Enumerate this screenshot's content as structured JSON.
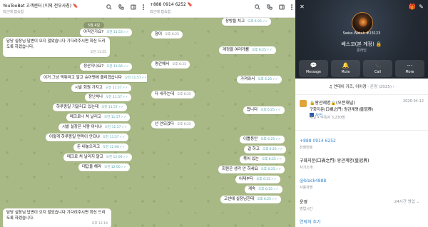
{
  "left": {
    "title": "YouTooBet 고객센터 (이외 전부사칭)",
    "title_badge": "🔖",
    "subtitle": "최근에 접속함",
    "date_chip": "5월 4일",
    "messages": [
      {
        "text": "아직인가요?",
        "time": "오전 11:53",
        "checks": "✓✓"
      },
      {
        "text": "담당 실장님 답변이 오지 않았습니다 기다려주시면 회신 드리도록 하겠습니다.",
        "time": "오전 11:55",
        "checks": ""
      },
      {
        "text": "정산지나요?",
        "time": "오전 11:56",
        "checks": "✓✓"
      },
      {
        "text": "이거 그냥 먹튀라고 알고 슈어맨에 올리겠습니다",
        "time": "오전 11:57",
        "checks": "✓✓"
      },
      {
        "text": "시발 회원 가지고",
        "time": "오전 11:57",
        "checks": "✓✓"
      },
      {
        "text": "장난치나",
        "time": "오전 11:57",
        "checks": "✓✓"
      },
      {
        "text": "하루종일 기달리고 있는데",
        "time": "오전 11:57",
        "checks": "✓✓"
      },
      {
        "text": "매크로나 처 날리고",
        "time": "오전 11:57",
        "checks": "✓✓"
      },
      {
        "text": "시발 실장은 사람 아니냐",
        "time": "오전 11:57",
        "checks": "✓✓"
      },
      {
        "text": "어떻게 하루종일 연락이 안되냐",
        "time": "오전 11:57",
        "checks": "✓✓"
      },
      {
        "text": "돈 내놓으라고",
        "time": "오전 12:00",
        "checks": "✓✓"
      },
      {
        "text": "매크로 처 날리지 말고",
        "time": "오전 12:00",
        "checks": "✓✓"
      },
      {
        "text": "대답을 해라",
        "time": "오전 12:00",
        "checks": "✓✓"
      },
      {
        "text": "담당 실장님 답변이 오지 않았습니다 기다려주시면 회신 드리도록 하겠습니다.",
        "time": "오후 12:14",
        "checks": ""
      }
    ]
  },
  "mid": {
    "title": "+888 0914 6252",
    "title_badge": "🔖",
    "subtitle": "최근에 접속함",
    "messages": [
      {
        "text": "장방을 치고",
        "time": "오후 6:25",
        "checks": "✓✓",
        "side": "out"
      },
      {
        "text": "형이",
        "time": "오후 6:25",
        "checks": "",
        "side": "in"
      },
      {
        "text": "계정을 여러개를",
        "time": "오후 6:25",
        "checks": "✓✓",
        "side": "out"
      },
      {
        "text": "명간해서",
        "time": "오후 6:25",
        "checks": "",
        "side": "in"
      },
      {
        "text": "가져와서",
        "time": "오후 6:25",
        "checks": "✓✓",
        "side": "out"
      },
      {
        "text": "다 내주는데",
        "time": "오후 6:25",
        "checks": "",
        "side": "in"
      },
      {
        "text": "합니다",
        "time": "오후 6:25",
        "checks": "✓✓",
        "side": "out"
      },
      {
        "text": "넌 안되겠다",
        "time": "오후 6:25",
        "checks": "",
        "side": "in"
      },
      {
        "text": "이틀동안",
        "time": "오후 6:25",
        "checks": "✓✓",
        "side": "out"
      },
      {
        "text": "걸 하고",
        "time": "오후 6:25",
        "checks": "✓✓",
        "side": "out"
      },
      {
        "text": "묶어 있는",
        "time": "오후 6:25",
        "checks": "✓✓",
        "side": "out"
      },
      {
        "text": "회원은 생각 안 하세요",
        "time": "오후 6:25",
        "checks": "✓✓",
        "side": "out"
      },
      {
        "text": "어제부터",
        "time": "오후 6:25",
        "checks": "✓✓",
        "side": "out"
      },
      {
        "text": "계속",
        "time": "오후 6:25",
        "checks": "✓✓",
        "side": "out"
      },
      {
        "text": "고센에 실장님한테",
        "time": "오후 6:25",
        "checks": "✓✓",
        "side": "out"
      }
    ]
  },
  "right": {
    "watch_label": "Swiss Watch #23123",
    "name": "베스코(본 계정)",
    "name_badge": "🔒",
    "status": "온라인",
    "actions": [
      {
        "label": "Message",
        "icon": "message-icon",
        "symbol": "💬"
      },
      {
        "label": "Mute",
        "icon": "bell-icon",
        "symbol": "🔔"
      },
      {
        "label": "Call",
        "icon": "phone-icon",
        "symbol": "📞"
      },
      {
        "label": "More",
        "icon": "more-icon",
        "symbol": "⋯"
      }
    ],
    "music": "♫ 언데이 키즈, 이어경",
    "music_sub": " - 운명 (2025) ›",
    "channel": {
      "title": "🔒왕관제명🔒(오픈채널)",
      "date": "2026-04-12",
      "message_prefix": "구화지문(口禍之門) 왕관계명(皇冠界)",
      "message_media": "사진",
      "info": "채널 • 구독자 3,230명"
    },
    "info": {
      "phone": "+888 0914 6252",
      "phone_label": "전화번호",
      "bio": "구화지문(口禍之門) 왕관계명(皇冠界)",
      "bio_label": "자기소개",
      "username": "@black4888",
      "username_label": "사용자명",
      "hours_value": "운영",
      "hours_label": "영업시간",
      "hours_right": "24시간 영업",
      "add_contact": "연락처 추가"
    }
  }
}
